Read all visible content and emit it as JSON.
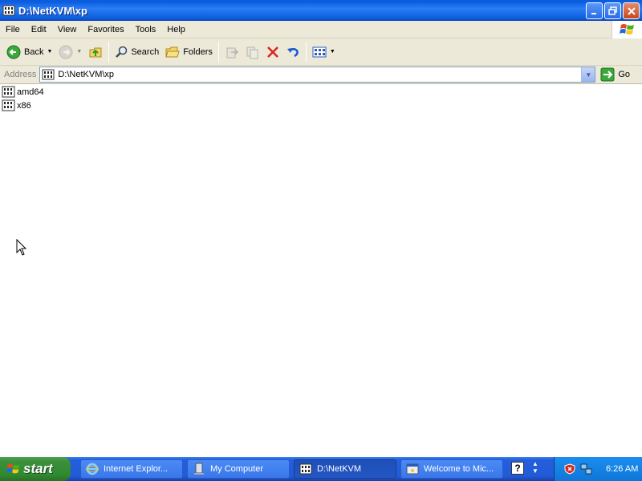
{
  "window": {
    "title": "D:\\NetKVM\\xp"
  },
  "menu": {
    "items": [
      "File",
      "Edit",
      "View",
      "Favorites",
      "Tools",
      "Help"
    ]
  },
  "toolbar": {
    "back_label": "Back",
    "search_label": "Search",
    "folders_label": "Folders"
  },
  "address": {
    "label": "Address",
    "value": "D:\\NetKVM\\xp",
    "go_label": "Go"
  },
  "files": [
    {
      "name": "amd64"
    },
    {
      "name": "x86"
    }
  ],
  "taskbar": {
    "start_label": "start",
    "tasks": [
      {
        "label": "Internet Explor..."
      },
      {
        "label": "My Computer"
      },
      {
        "label": "D:\\NetKVM"
      },
      {
        "label": "Welcome to Mic..."
      }
    ],
    "clock": "6:26 AM"
  },
  "colors": {
    "titlebar": "#0b5be0",
    "chrome": "#ece9d8",
    "taskbar": "#245edc",
    "start": "#3c8f3c",
    "tray": "#0f76d8"
  }
}
